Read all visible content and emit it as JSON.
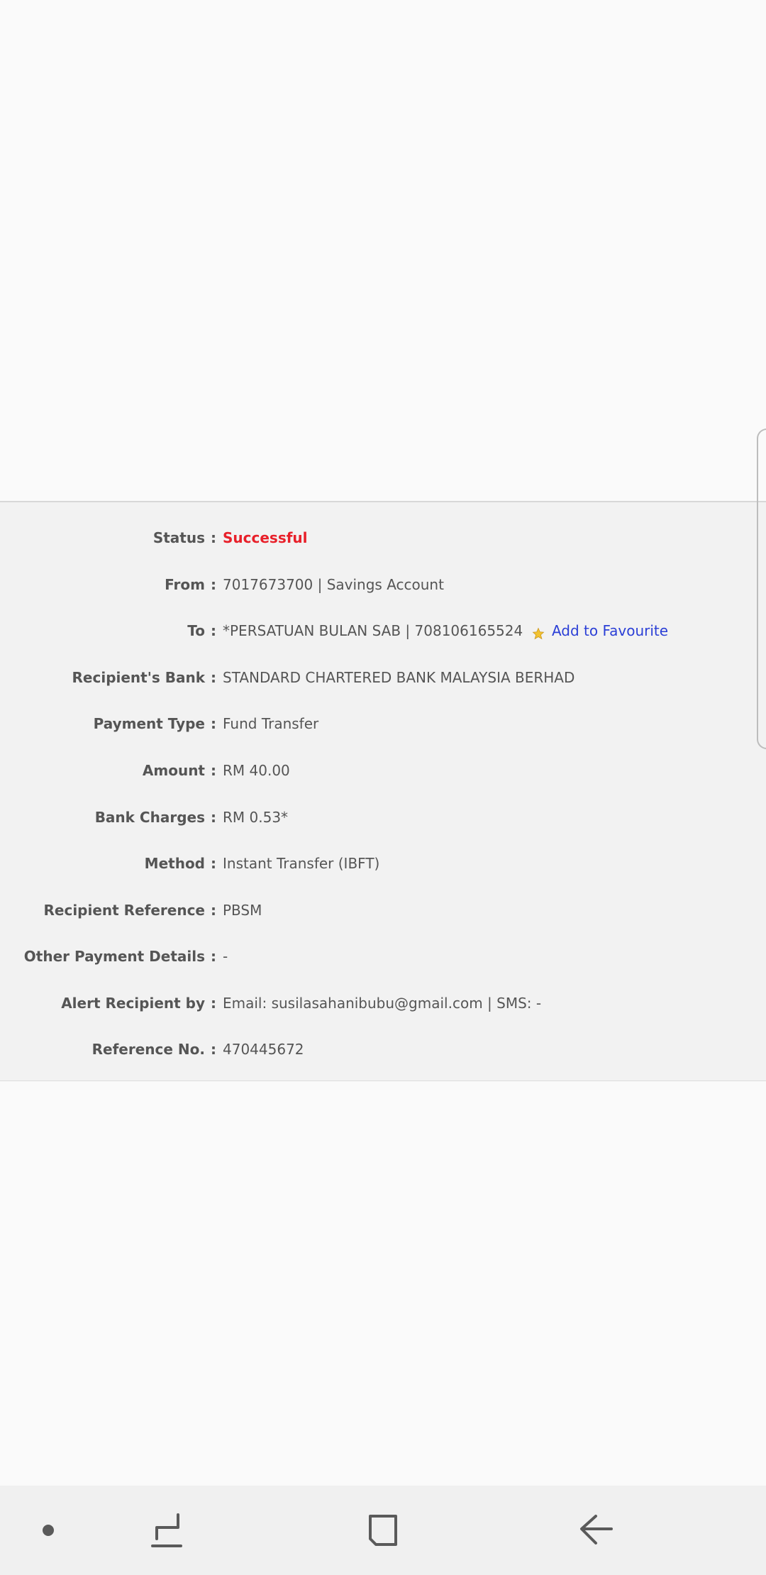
{
  "transfer_details": {
    "status": {
      "label": "Status",
      "colon": ":",
      "value": "Successful"
    },
    "from": {
      "label": "From",
      "colon": ":",
      "value": "7017673700 | Savings Account"
    },
    "to": {
      "label": "To",
      "colon": ":",
      "value": "*PERSATUAN BULAN SAB | 708106165524",
      "favourite_label": "Add to Favourite",
      "favourite_icon": "star-icon"
    },
    "recipient_bank": {
      "label": "Recipient's Bank",
      "colon": ":",
      "value": "STANDARD CHARTERED BANK MALAYSIA BERHAD"
    },
    "payment_type": {
      "label": "Payment Type",
      "colon": ":",
      "value": "Fund Transfer"
    },
    "amount": {
      "label": "Amount",
      "colon": ":",
      "value": "RM 40.00"
    },
    "bank_charges": {
      "label": "Bank Charges",
      "colon": ":",
      "value": "RM 0.53*"
    },
    "method": {
      "label": "Method",
      "colon": ":",
      "value": "Instant Transfer (IBFT)"
    },
    "recipient_reference": {
      "label": "Recipient Reference",
      "colon": ":",
      "value": "PBSM"
    },
    "other_payment_details": {
      "label": "Other Payment Details",
      "colon": ":",
      "value": "-"
    },
    "alert_recipient": {
      "label": "Alert Recipient by",
      "colon": ":",
      "value": "Email: susilasahanibubu@gmail.com | SMS: -"
    },
    "reference_no": {
      "label": "Reference No.",
      "colon": ":",
      "value": "470445672"
    }
  },
  "colors": {
    "success": "#e8202a",
    "link": "#2b3fd6",
    "text": "#555555",
    "panel_bg": "#f2f2f2",
    "page_bg": "#fafafa"
  },
  "navigation_bar": {
    "buttons": [
      {
        "name": "dot-icon"
      },
      {
        "name": "recent-apps-icon"
      },
      {
        "name": "home-icon"
      },
      {
        "name": "back-icon"
      }
    ]
  }
}
